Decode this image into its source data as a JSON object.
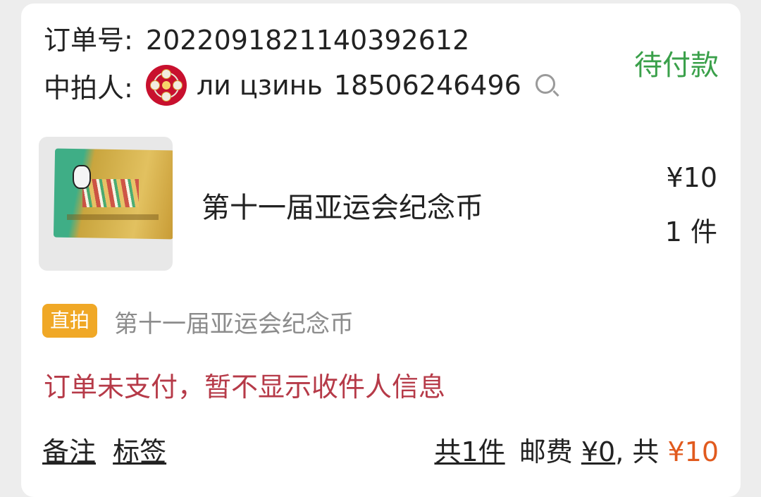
{
  "order": {
    "order_no_label": "订单号:",
    "order_no": "2022091821140392612",
    "status": "待付款",
    "status_color": "#3aa04a"
  },
  "buyer": {
    "label": "中拍人:",
    "name": "ли цзинь",
    "phone": "18506246496",
    "search_icon": "search-icon"
  },
  "item": {
    "title": "第十一届亚运会纪念币",
    "price": "¥10",
    "quantity": "1 件"
  },
  "tag": {
    "badge": "直拍",
    "badge_color": "#f0a826",
    "subtitle": "第十一届亚运会纪念币"
  },
  "notice": {
    "text": "订单未支付，暂不显示收件人信息",
    "color": "#b63a48"
  },
  "footer": {
    "remark": "备注",
    "label_tag": "标签",
    "count": "共1件",
    "shipping_label": "邮费",
    "shipping_value": "¥0",
    "total_prefix": ", 共",
    "total": "¥10",
    "total_color": "#e15a1e"
  }
}
